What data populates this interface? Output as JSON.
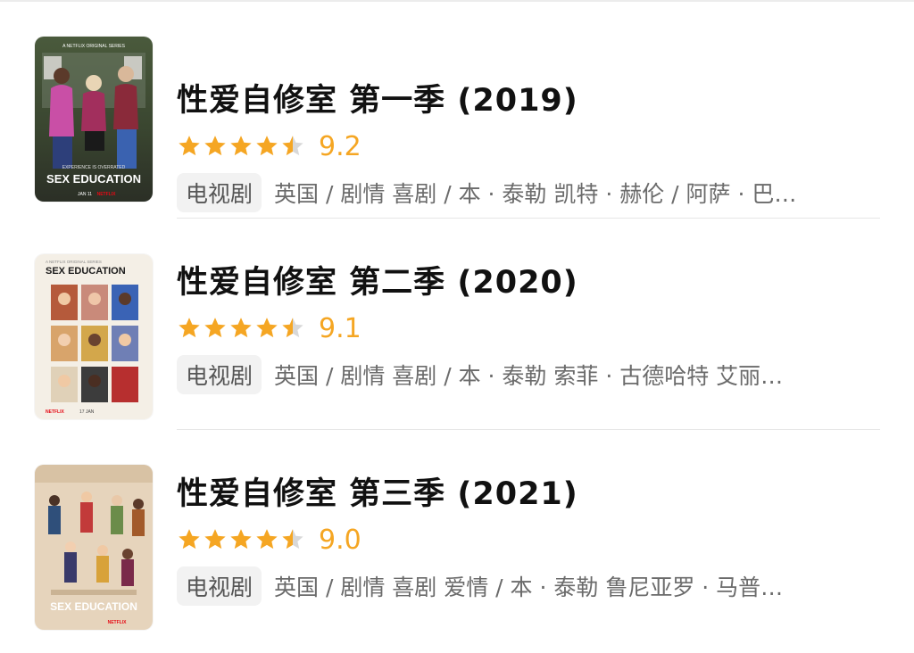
{
  "results": [
    {
      "title": "性爱自修室 第一季  (2019)",
      "rating_stars": 4.5,
      "score": "9.2",
      "tag": "电视剧",
      "meta": "英国 / 剧情 喜剧 / 本 · 泰勒 凯特 · 赫伦 / 阿萨 · 巴…",
      "poster": {
        "top_text": "A NETFLIX ORIGINAL SERIES",
        "tagline": "EXPERIENCE IS OVERRATED",
        "logo": "SEX EDUCATION",
        "footer": "JAN 11",
        "brand": "NETFLIX"
      }
    },
    {
      "title": "性爱自修室 第二季  (2020)",
      "rating_stars": 4.5,
      "score": "9.1",
      "tag": "电视剧",
      "meta": "英国 / 剧情 喜剧 / 本 · 泰勒 索菲 · 古德哈特 艾丽…",
      "poster": {
        "top_text": "A NETFLIX ORIGINAL SERIES",
        "logo": "SEX EDUCATION",
        "footer": "17 JAN",
        "brand": "NETFLIX"
      }
    },
    {
      "title": "性爱自修室 第三季  (2021)",
      "rating_stars": 4.5,
      "score": "9.0",
      "tag": "电视剧",
      "meta": "英国 / 剧情 喜剧 爱情 / 本 · 泰勒 鲁尼亚罗 · 马普…",
      "poster": {
        "logo": "SEX EDUCATION",
        "brand": "NETFLIX"
      }
    }
  ],
  "colors": {
    "star": "#f5a623",
    "star_empty": "#d8d8d8",
    "tag_bg": "#f2f2f2",
    "title": "#111111",
    "meta": "#6b6b6b"
  }
}
